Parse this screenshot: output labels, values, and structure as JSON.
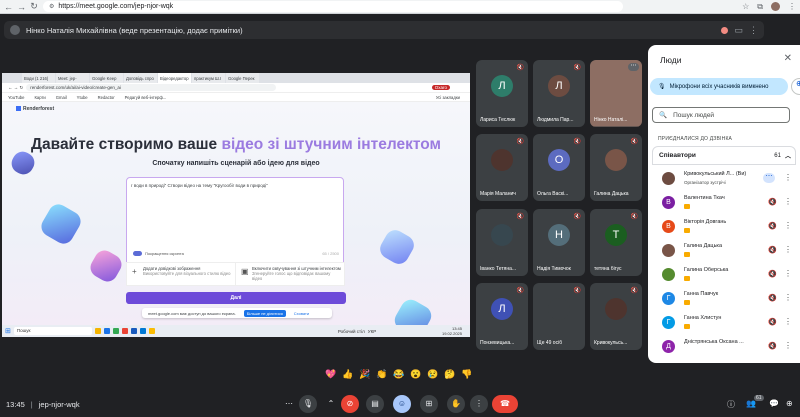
{
  "browser": {
    "url": "https://meet.google.com/jep-njor-wqk"
  },
  "presentation_bar": {
    "text": "Нінко Наталія Михайлівна (веде презентацію, додає примітки)"
  },
  "shared_screen": {
    "tabs": [
      "Води (1 216)",
      "Meet: jep-",
      "Google Keep",
      "Доповідь спро",
      "Відеоредактор",
      "практикум Ш.І",
      "Google Перек"
    ],
    "url": "renderforest.com/uk/ai/ai-video/create-gen_ai",
    "profile": "Oxaro",
    "bookmarks": [
      "YouTube",
      "Карти",
      "Gmail",
      "Ytube",
      "Redactor",
      "Редагуй веб-інтерф...",
      "Усі закладки"
    ],
    "logo": "Renderforest",
    "headline_a": "Давайте створимо ваше ",
    "headline_b": "відео зі штучним інтелектом",
    "subhead": "Спочатку напишіть сценарій або ідею для відео",
    "prompt_text": "г води в природі\" Створи відео на тему \"Кругообіг води в природі\"",
    "toggle_label": "Покращення скрипта",
    "char_count": "65 / 2500",
    "option1_title": "Додати довідкові зображення",
    "option1_sub": "Використовуйте для візуального стилю відео",
    "option2_title": "Включити озвучування зі штучним інтелектом",
    "option2_sub": "Згенеруйте голос що відповідає вашому відео",
    "submit": "Далі",
    "share_banner": {
      "text": "meet.google.com має доступ до вашого екрана.",
      "stop": "Більше не ділитися",
      "hide": "Сховати"
    },
    "taskbar": {
      "search": "Пошук",
      "status": "Робочий стіл",
      "lang": "УКР",
      "time": "13:45",
      "date": "19.02.2025"
    }
  },
  "tiles": [
    {
      "name": "Лариса Теслюк",
      "initial": "Л",
      "color": "#2e7d6a"
    },
    {
      "name": "Людмила Пар...",
      "initial": "Л",
      "color": "#6d4c41"
    },
    {
      "name": "Нінко Наталі...",
      "initial": "",
      "color": "#8d6e63"
    },
    {
      "name": "Марія Маланич",
      "initial": "",
      "color": "#4e342e"
    },
    {
      "name": "Ольга Васкі...",
      "initial": "О",
      "color": "#5c6bc0"
    },
    {
      "name": "Галина Дацька",
      "initial": "",
      "color": "#795548"
    },
    {
      "name": "Іванко Тетяна...",
      "initial": "",
      "color": "#37474f"
    },
    {
      "name": "Надія Тимочок",
      "initial": "Н",
      "color": "#546e7a"
    },
    {
      "name": "тетяна бігус",
      "initial": "Т",
      "color": "#1b5e20"
    },
    {
      "name": "Понзевицька...",
      "initial": "Л",
      "color": "#3f51b5"
    },
    {
      "name": "Ще 49 осіб",
      "initial": "",
      "color": "#3c4043"
    },
    {
      "name": "Кривокульсь...",
      "initial": "",
      "color": "#4e342e"
    }
  ],
  "people_panel": {
    "title": "Люди",
    "mic_button": "Мікрофони всіх учасників вимкнено",
    "search_placeholder": "Пошук людей",
    "section": "ПРИЄДНАЛИСЯ ДО ДЗВІНКА",
    "group": "Співавтори",
    "group_count": "61",
    "people": [
      {
        "name": "Кривокульський Л...  (Ви)",
        "sub": "Організатор зустрічі",
        "initial": "",
        "color": "#6d4c41",
        "badge": false
      },
      {
        "name": "Валентина Ткач",
        "sub": "",
        "initial": "В",
        "color": "#7b1fa2",
        "badge": true
      },
      {
        "name": "Вікторія Довгань",
        "sub": "",
        "initial": "В",
        "color": "#e64a19",
        "badge": true
      },
      {
        "name": "Галина Дацька",
        "sub": "",
        "initial": "",
        "color": "#795548",
        "badge": true
      },
      {
        "name": "Галина Оберська",
        "sub": "",
        "initial": "",
        "color": "#558b2f",
        "badge": true
      },
      {
        "name": "Ганна Павчук",
        "sub": "",
        "initial": "Г",
        "color": "#1e88e5",
        "badge": true
      },
      {
        "name": "Ганна Хлистун",
        "sub": "",
        "initial": "Г",
        "color": "#039be5",
        "badge": true
      },
      {
        "name": "Дністрянська Оксана ...",
        "sub": "",
        "initial": "Д",
        "color": "#8e24aa",
        "badge": false
      }
    ]
  },
  "reactions": [
    "💖",
    "👍",
    "🎉",
    "👏",
    "😂",
    "😮",
    "😢",
    "🤔",
    "👎"
  ],
  "bottom": {
    "time": "13:45",
    "separator": "|",
    "code": "jep-njor-wqk",
    "people_count": "61"
  }
}
